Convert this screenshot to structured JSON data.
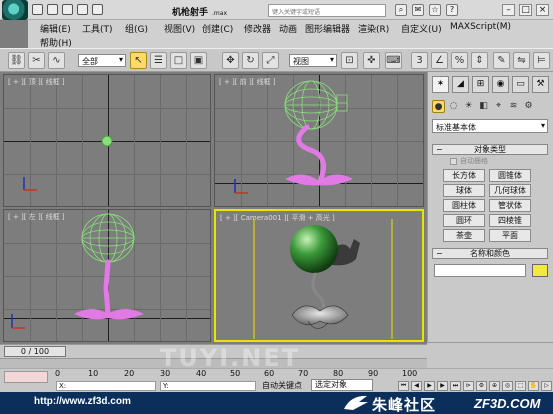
{
  "titlebar": {
    "title": "机枪射手",
    "title_sub": ".max",
    "search_placeholder": "键入关键字或短语",
    "win_buttons": [
      "–",
      "□",
      "×"
    ]
  },
  "menubar": {
    "items": [
      "编辑(E)",
      "工具(T)",
      "组(G)",
      "视图(V)",
      "创建(C)",
      "修改器",
      "动画",
      "图形编辑器",
      "渲染(R)",
      "自定义(U)",
      "MAXScript(M)"
    ],
    "help": "帮助(H)"
  },
  "toolbar": {
    "selection_filter": "全部",
    "ref_coord": "视图"
  },
  "viewports": {
    "top_label": "[ + ][ 顶 ][ 线框 ]",
    "front_label": "[ + ][ 前 ][ 线框 ]",
    "left_label": "[ + ][ 左 ][ 线框 ]",
    "persp_label": "[ + ][ Camera001 ][ 平滑 + 高光 ]"
  },
  "command_panel": {
    "category": "标准基本体",
    "object_type_header": "对象类型",
    "autogrid_label": "自动栅格",
    "buttons": [
      "长方体",
      "圆锥体",
      "球体",
      "几何球体",
      "圆柱体",
      "管状体",
      "圆环",
      "四棱锥",
      "茶壶",
      "平面"
    ],
    "name_color_header": "名称和颜色",
    "accent_color": "#f2e840"
  },
  "timeline": {
    "frame_display": "0 / 100",
    "ruler_ticks": [
      "0",
      "10",
      "20",
      "30",
      "40",
      "50",
      "60",
      "70",
      "80",
      "90",
      "100"
    ],
    "auto_key_label": "自动关键点",
    "set_key_mode": "选定对象",
    "progress": 0
  },
  "status": {
    "x_label": "X:",
    "y_label": "Y:"
  },
  "watermark": {
    "url": "http://www.zf3d.com",
    "cn_name": "朱峰社区",
    "domain": "ZF3D.COM",
    "overlay_text": "TUYI.NET"
  },
  "colors": {
    "selection_green": "#88e07a",
    "stem_pink": "#e27ae6",
    "viewport_grey": "#7d7d7d",
    "active_border": "#f0e000"
  }
}
